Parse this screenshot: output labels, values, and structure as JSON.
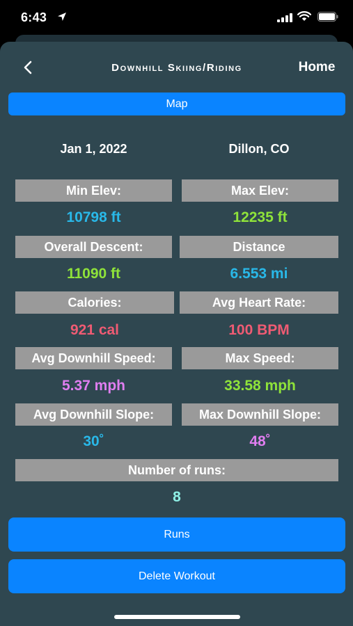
{
  "status": {
    "time": "6:43"
  },
  "nav": {
    "title": "Downhill Skiing/Riding",
    "home": "Home"
  },
  "map_label": "Map",
  "info": {
    "date": "Jan 1, 2022",
    "location": "Dillon, CO"
  },
  "stats": {
    "min_elev": {
      "label": "Min Elev:",
      "value": "10798 ft",
      "color": "#29b8e8"
    },
    "max_elev": {
      "label": "Max Elev:",
      "value": "12235 ft",
      "color": "#8fe33a"
    },
    "descent": {
      "label": "Overall Descent:",
      "value": "11090 ft",
      "color": "#8fe33a"
    },
    "distance": {
      "label": "Distance",
      "value": "6.553 mi",
      "color": "#29b8e8"
    },
    "calories": {
      "label": "Calories:",
      "value": "921 cal",
      "color": "#ef5b73"
    },
    "heart_rate": {
      "label": "Avg Heart Rate:",
      "value": "100 BPM",
      "color": "#ef5b73"
    },
    "avg_speed": {
      "label": "Avg Downhill Speed:",
      "value": "5.37 mph",
      "color": "#e07ef0"
    },
    "max_speed": {
      "label": "Max Speed:",
      "value": "33.58 mph",
      "color": "#8fe33a"
    },
    "avg_slope": {
      "label": "Avg Downhill Slope:",
      "value": "30˚",
      "color": "#29b8e8"
    },
    "max_slope": {
      "label": "Max Downhill Slope:",
      "value": "48˚",
      "color": "#e07ef0"
    },
    "runs_count": {
      "label": "Number of runs:",
      "value": "8",
      "color": "#8ff0e6"
    }
  },
  "buttons": {
    "runs": "Runs",
    "delete": "Delete Workout"
  },
  "colors": {
    "accent": "#0a84ff",
    "sheet": "#2f4750",
    "label_bg": "#9a9a9a"
  }
}
